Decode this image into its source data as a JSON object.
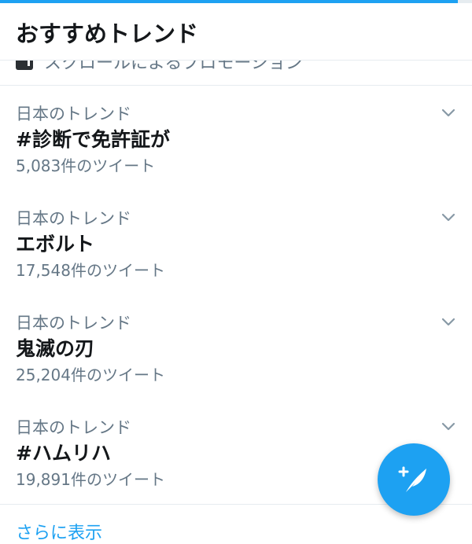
{
  "header": {
    "title": "おすすめトレンド"
  },
  "promo": {
    "text": "スクロールによるプロモーション"
  },
  "trends": [
    {
      "context": "日本のトレンド",
      "name": "#診断で免許証が",
      "count": "5,083件のツイート"
    },
    {
      "context": "日本のトレンド",
      "name": "エボルト",
      "count": "17,548件のツイート"
    },
    {
      "context": "日本のトレンド",
      "name": "鬼滅の刃",
      "count": "25,204件のツイート"
    },
    {
      "context": "日本のトレンド",
      "name": "#ハムリハ",
      "count": "19,891件のツイート"
    }
  ],
  "footer": {
    "show_more": "さらに表示"
  },
  "colors": {
    "accent": "#1da1f2",
    "secondary_text": "#657786",
    "divider": "#e6ecf0"
  },
  "icons": {
    "chevron": "chevron-down-icon",
    "compose": "compose-tweet-icon",
    "promo": "promoted-icon"
  },
  "load_progress": 0.97
}
